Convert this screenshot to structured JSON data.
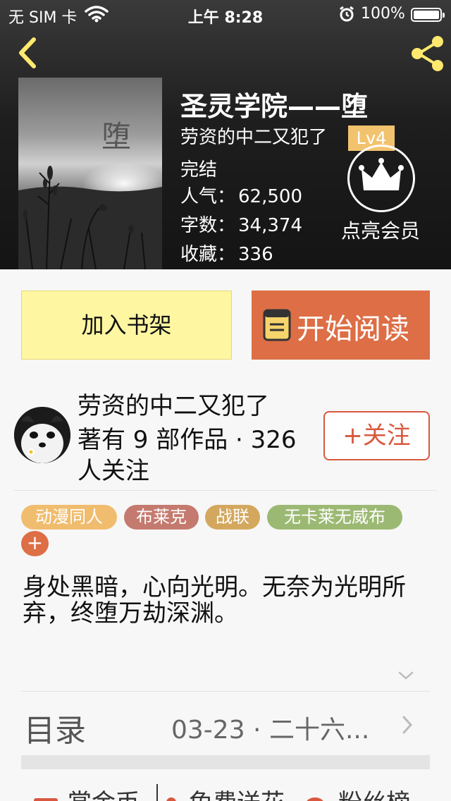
{
  "status_bar": {
    "carrier": "无 SIM 卡",
    "time": "上午 8:28",
    "battery": "100%"
  },
  "icons": {
    "back": "chevron-left-icon",
    "share": "share-icon",
    "vip": "crown-icon",
    "read": "book-icon",
    "expand": "chevron-down-icon",
    "toc": "chevron-right-icon"
  },
  "colors": {
    "accent_yellow": "#fee96e",
    "read_button": "#dd6e45",
    "shelf_button": "#fef6a1",
    "follow": "#d9583f",
    "level_badge": "#f2c36e"
  },
  "book": {
    "title": "圣灵学院——堕",
    "cover_title": "堕",
    "author": "劳资的中二又犯了",
    "level": "Lv4",
    "status": "完结",
    "popularity_label": "人气：",
    "popularity": "62,500",
    "wordcount_label": "字数：",
    "wordcount": "34,374",
    "favorites_label": "收藏：",
    "favorites": "336",
    "vip_label": "点亮会员"
  },
  "actions": {
    "add_shelf": "加入书架",
    "start_reading": "开始阅读"
  },
  "author_block": {
    "name": "劳资的中二又犯了",
    "works": "著有 9 部作品 · 326 人关注",
    "follow": "+关注"
  },
  "tags": [
    "动漫同人",
    "布莱克",
    "战联",
    "无卡莱无威布"
  ],
  "tag_add": "+",
  "synopsis": "身处黑暗，心向光明。无奈为光明所弃，终堕万劫深渊。",
  "toc": {
    "label": "目录",
    "latest": "03-23 · 二十六..."
  },
  "bottom_bar": {
    "coin": "赏金币",
    "flower": "免费送花",
    "fans": "粉丝榜"
  }
}
